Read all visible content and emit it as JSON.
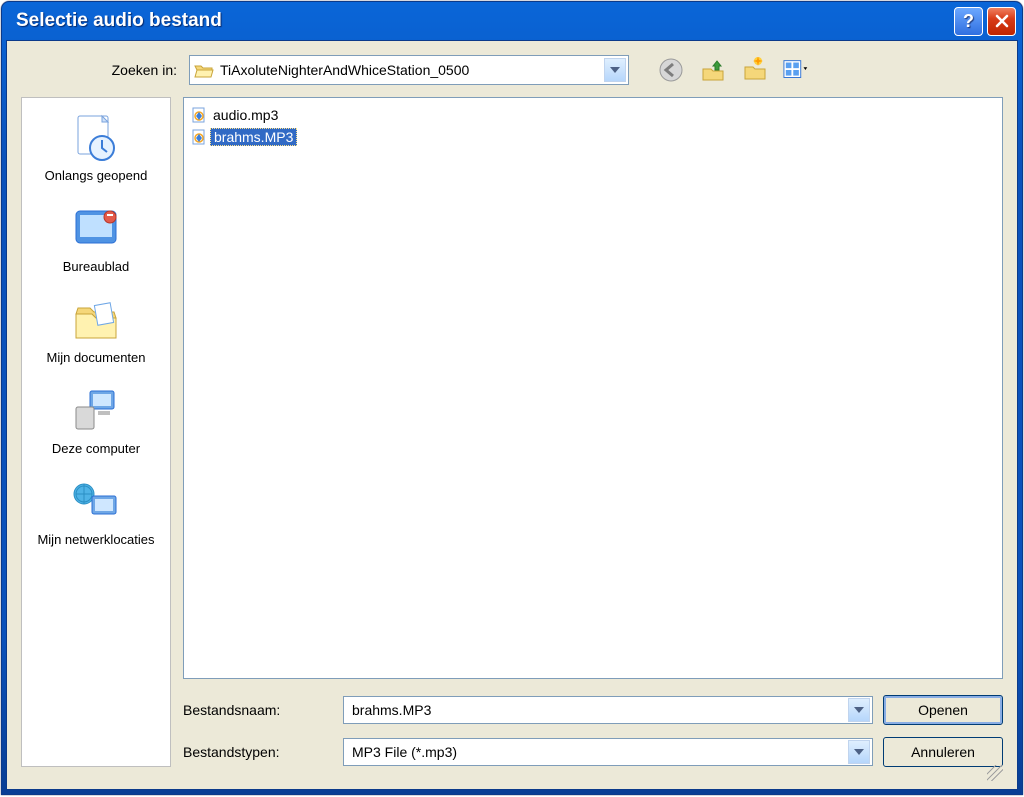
{
  "window": {
    "title": "Selectie audio bestand"
  },
  "lookin": {
    "label": "Zoeken in:",
    "folder": "TiAxoluteNighterAndWhiceStation_0500"
  },
  "nav": {
    "back": "back-icon",
    "up": "up-icon",
    "newfolder": "new-folder-icon",
    "viewmenu": "view-menu-icon"
  },
  "places": [
    {
      "id": "recent",
      "label": "Onlangs geopend"
    },
    {
      "id": "desktop",
      "label": "Bureaublad"
    },
    {
      "id": "mydocs",
      "label": "Mijn documenten"
    },
    {
      "id": "mycomp",
      "label": "Deze computer"
    },
    {
      "id": "network",
      "label": "Mijn netwerklocaties"
    }
  ],
  "files": [
    {
      "name": "audio.mp3",
      "selected": false
    },
    {
      "name": "brahms.MP3",
      "selected": true
    }
  ],
  "filename": {
    "label": "Bestandsnaam:",
    "value": "brahms.MP3"
  },
  "filetype": {
    "label": "Bestandstypen:",
    "value": "MP3 File (*.mp3)"
  },
  "buttons": {
    "open": "Openen",
    "cancel": "Annuleren"
  }
}
